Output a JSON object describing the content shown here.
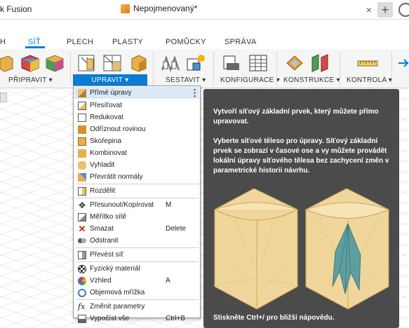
{
  "app": {
    "title": "k Fusion"
  },
  "document": {
    "tab_title": "Nepojmenovaný*",
    "close_glyph": "×",
    "new_tab_glyph": "+"
  },
  "workspace_tabs": [
    "H",
    "SÍŤ",
    "PLECH",
    "PLASTY",
    "POMŮCKY",
    "SPRÁVA"
  ],
  "active_tab": "SÍŤ",
  "ribbon_groups": {
    "pripravit": "PŘIPRAVIT ▾",
    "upravit": "UPRAVIT ▾",
    "sestavit": "SESTAVIT ▾",
    "konfigurace": "KONFIGURACE ▾",
    "konstrukce": "KONSTRUKCE ▾",
    "kontrola": "KONTROLA ▾"
  },
  "menu": {
    "items": [
      {
        "label": "Přímé úpravy",
        "icon": "direct-edit-icon",
        "highlighted": true,
        "more": "⋮"
      },
      {
        "label": "Přesíťovat",
        "icon": "remesh-icon"
      },
      {
        "label": "Redukovat",
        "icon": "reduce-icon"
      },
      {
        "label": "Odříznout rovinou",
        "icon": "plane-cut-icon"
      },
      {
        "label": "Skořepina",
        "icon": "shell-icon"
      },
      {
        "label": "Kombinovat",
        "icon": "combine-icon"
      },
      {
        "label": "Vyhladit",
        "icon": "smooth-icon"
      },
      {
        "label": "Převrátit normály",
        "icon": "reverse-normal-icon"
      },
      {
        "label": "Rozdělit",
        "icon": "separate-icon"
      },
      {
        "label": "Přesunout/Kopírovat",
        "icon": "move-icon",
        "shortcut": "M"
      },
      {
        "label": "Měřítko sítě",
        "icon": "scale-icon"
      },
      {
        "label": "Smazat",
        "icon": "delete-icon",
        "shortcut": "Delete"
      },
      {
        "label": "Odstranit",
        "icon": "remove-icon"
      },
      {
        "label": "Převést síť",
        "icon": "convert-mesh-icon"
      },
      {
        "label": "Fyzický materiál",
        "icon": "physical-material-icon"
      },
      {
        "label": "Vzhled",
        "icon": "appearance-icon",
        "shortcut": "A"
      },
      {
        "label": "Objemová mřížka",
        "icon": "volumetric-lattice-icon"
      },
      {
        "label": "Změnit parametry",
        "icon": "change-parameters-icon"
      },
      {
        "label": "Vypočíst vše",
        "icon": "compute-all-icon",
        "shortcut": "Ctrl+B"
      }
    ]
  },
  "tooltip": {
    "intro": "Vytvoří síťový základní prvek, který můžete přímo upravovat.",
    "body": "Vyberte síťové těleso pro úpravy. Síťový základní prvek se zobrazí v časové ose a vy můžete provádět lokální úpravy síťového tělesa bez zachycení změn v parametrické historii návrhu.",
    "footer": "Stiskněte Ctrl+/ pro bližší nápovědu."
  },
  "colors": {
    "accent": "#0a7cd2",
    "tooltip_bg": "#4b4b4b",
    "mesh_fill": "#f0d69b",
    "mesh_teal": "#5f9ea0"
  }
}
